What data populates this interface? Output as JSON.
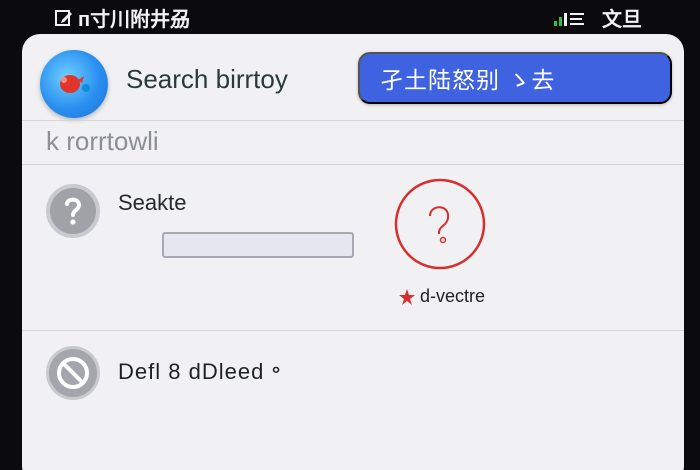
{
  "status_bar": {
    "left_text": "ᴨ寸川附井刕",
    "right_text": "文旦",
    "left_icon": "edit-icon",
    "right_icon": "signal-icon"
  },
  "header": {
    "app_icon": "bird-app-icon",
    "title": "Search birrtoy",
    "primary_button_label": "孑土陆怒别 ゝ去"
  },
  "subheader": {
    "text": "k rorrtowli"
  },
  "section1": {
    "icon": "question-icon",
    "label": "Seakte",
    "input_value": "",
    "help_icon": "help-circle-icon",
    "tag_icon": "star-icon",
    "tag_text": "d-vectre",
    "accent_color": "#d62f2f"
  },
  "section2": {
    "icon": "block-icon",
    "label": "Defl 8 dDleed ॰"
  },
  "colors": {
    "primary": "#3f63e0",
    "background": "#f1f1f3",
    "status_bar": "#0b0b0e"
  }
}
